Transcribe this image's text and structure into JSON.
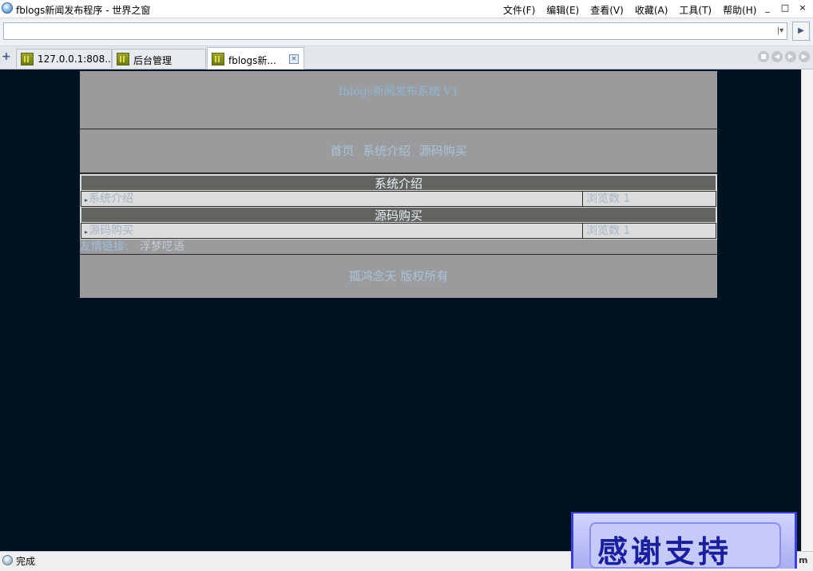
{
  "window": {
    "title": "fblogs新闻发布程序 - 世界之窗",
    "menu": [
      "文件(F)",
      "编辑(E)",
      "查看(V)",
      "收藏(A)",
      "工具(T)",
      "帮助(H)"
    ],
    "controls": [
      "_",
      "□",
      "×"
    ]
  },
  "address_bar": {
    "value": "",
    "dropdown_glyph": "|▾",
    "go_glyph": "▶"
  },
  "tabs": [
    {
      "label": "127.0.0.1:808..."
    },
    {
      "label": "后台管理"
    },
    {
      "label": "fblogs新..."
    }
  ],
  "site": {
    "header_title": "fblogs新闻发布系统 V1",
    "nav": [
      "首页",
      "系统介绍",
      "源码购买"
    ],
    "categories": [
      {
        "heading": "系统介绍",
        "item": "系统介绍",
        "count_text": "浏览数 1"
      },
      {
        "heading": "源码购买",
        "item": "源码购买",
        "count_text": "浏览数 1"
      }
    ],
    "links_label": "友情链接:",
    "friend_link": "浮梦呓语",
    "footer": "孤鸿念天 版权所有"
  },
  "status": {
    "text": "完成",
    "right_text": "m"
  },
  "overlay": {
    "text": "感谢支持"
  },
  "colors": {
    "page_bg": "#021222",
    "block_bg": "#9b9a9c",
    "heading_bg": "#626460",
    "link_text": "#a8c4dc",
    "overlay_text": "#1a1f9c"
  }
}
